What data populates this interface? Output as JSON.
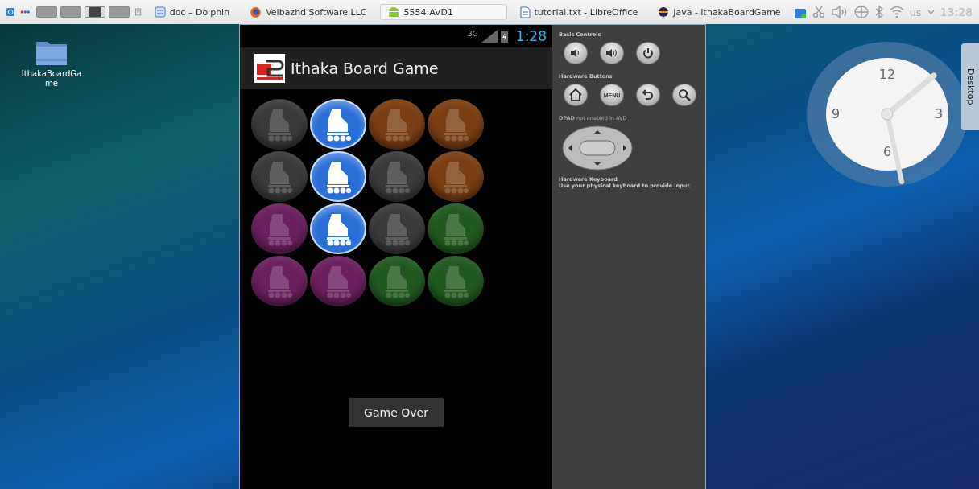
{
  "taskbar": {
    "tasks": [
      {
        "kind": "folder",
        "label": "doc – Dolphin"
      },
      {
        "kind": "browser",
        "label": "Velbazhd Software LLC"
      },
      {
        "kind": "android",
        "label": "5554:AVD1"
      },
      {
        "kind": "document",
        "label": "tutorial.txt - LibreOffice"
      },
      {
        "kind": "ide",
        "label": "Java - IthakaBoardGame"
      }
    ],
    "keyboard_layout": "us",
    "clock": "13:28"
  },
  "desktop": {
    "icons": [
      {
        "label": "IthakaBoardGame"
      }
    ],
    "panel_tab": "Desktop",
    "clock_numerals": [
      "12",
      "3",
      "6",
      "9"
    ]
  },
  "phone": {
    "status_bar": {
      "network": "3G",
      "time": "1:28"
    },
    "app_title": "Ithaka Board Game",
    "board": {
      "rows": [
        {
          "cells": [
            {
              "color": "#3a3a3a",
              "highlighted": false
            },
            {
              "color": "#2a6fd8",
              "highlighted": true
            },
            {
              "color": "#7a3e12",
              "highlighted": false
            },
            {
              "color": "#7a3e12",
              "highlighted": false
            }
          ]
        },
        {
          "cells": [
            {
              "color": "#3a3a3a",
              "highlighted": false
            },
            {
              "color": "#2a6fd8",
              "highlighted": true
            },
            {
              "color": "#3a3a3a",
              "highlighted": false
            },
            {
              "color": "#7a3e12",
              "highlighted": false
            }
          ]
        },
        {
          "cells": [
            {
              "color": "#6a1f5e",
              "highlighted": false
            },
            {
              "color": "#2a6fd8",
              "highlighted": true
            },
            {
              "color": "#3a3a3a",
              "highlighted": false
            },
            {
              "color": "#1f5a1f",
              "highlighted": false
            }
          ]
        },
        {
          "cells": [
            {
              "color": "#6a1f5e",
              "highlighted": false
            },
            {
              "color": "#6a1f5e",
              "highlighted": false
            },
            {
              "color": "#1f5a1f",
              "highlighted": false
            },
            {
              "color": "#1f5a1f",
              "highlighted": false
            }
          ]
        }
      ]
    },
    "button": "Game Over"
  },
  "emulator_controls": {
    "basic_controls": {
      "title": "Basic Controls",
      "buttons": [
        {
          "kind": "volume-down"
        },
        {
          "kind": "volume-up"
        },
        {
          "kind": "power"
        }
      ]
    },
    "hardware_buttons": {
      "title": "Hardware Buttons",
      "buttons": [
        {
          "kind": "home"
        },
        {
          "kind": "menu",
          "label": "MENU"
        },
        {
          "kind": "back"
        },
        {
          "kind": "search"
        }
      ]
    },
    "dpad_note": "**DPAD** not enabled in AVD",
    "keyboard_title": "Hardware Keyboard",
    "keyboard_note": "Use your physical keyboard to provide input"
  }
}
